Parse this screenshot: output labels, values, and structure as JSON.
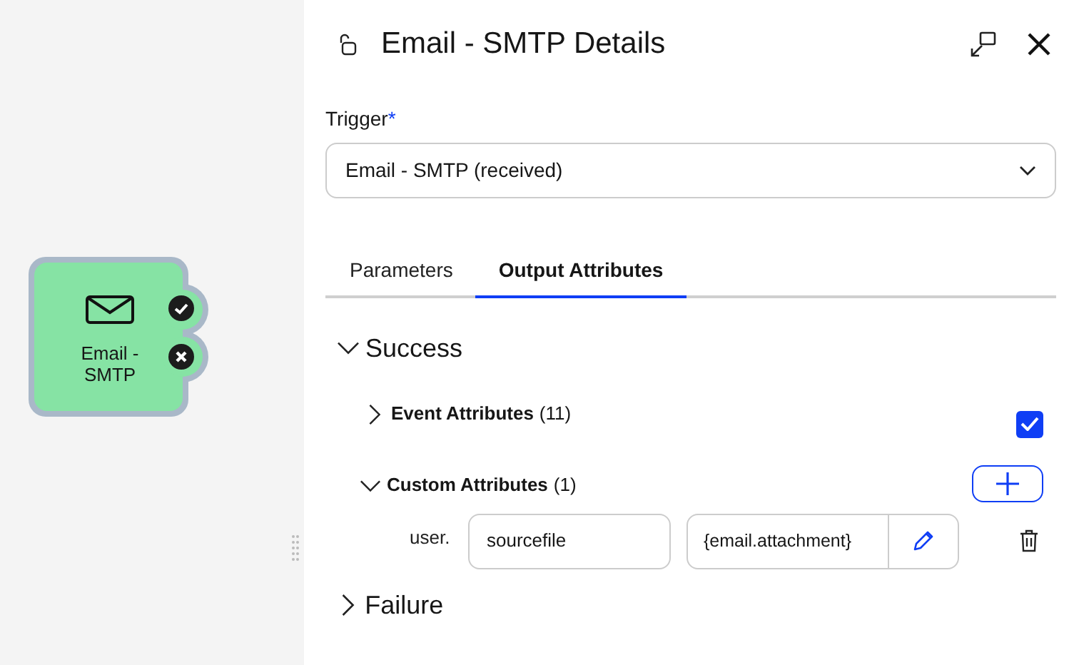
{
  "canvas": {
    "node": {
      "label": "Email - SMTP"
    }
  },
  "panel": {
    "title": "Email - SMTP Details",
    "trigger": {
      "label": "Trigger",
      "required_mark": "*",
      "value": "Email - SMTP (received)"
    },
    "tabs": [
      {
        "label": "Parameters",
        "selected": false
      },
      {
        "label": "Output Attributes",
        "selected": true
      }
    ],
    "sections": [
      {
        "title": "Success",
        "expanded": true,
        "groups": [
          {
            "kind": "checkbox",
            "title": "Event Attributes",
            "count": "(11)",
            "expanded": false,
            "checked": true
          },
          {
            "kind": "custom",
            "title": "Custom Attributes",
            "count": "(1)",
            "expanded": true,
            "attributes": [
              {
                "prefix": "user.",
                "name": "sourcefile",
                "value": "{email.attachment}"
              }
            ]
          }
        ]
      },
      {
        "title": "Failure",
        "expanded": false
      }
    ]
  }
}
